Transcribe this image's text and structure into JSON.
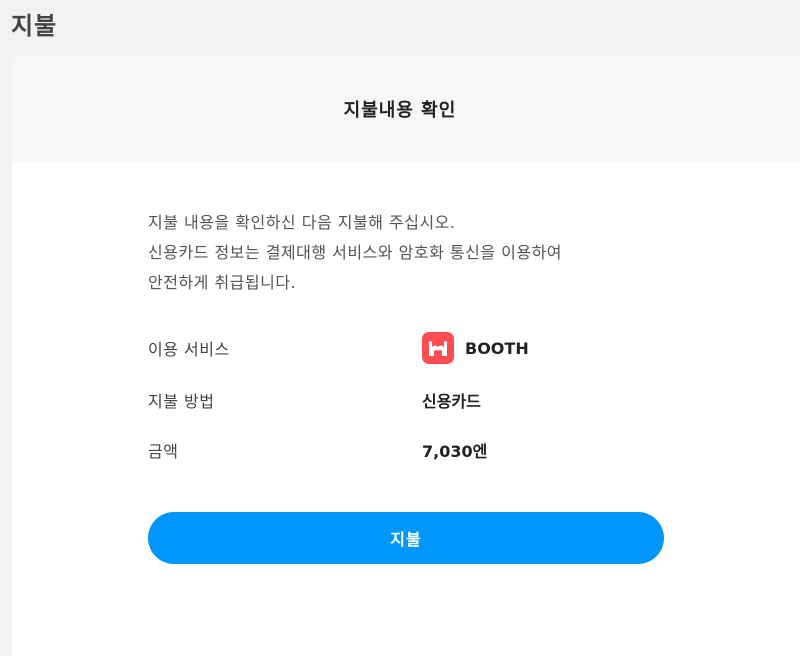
{
  "page": {
    "title": "지불"
  },
  "card": {
    "header_title": "지불내용 확인",
    "notice_lines": [
      "지불 내용을 확인하신 다음 지불해 주십시오.",
      "신용카드 정보는 결제대행 서비스와 암호화 통신을 이용하여",
      "안전하게 취급됩니다."
    ],
    "rows": [
      {
        "label": "이용 서비스",
        "value": "BOOTH",
        "icon": "booth-logo-icon"
      },
      {
        "label": "지불 방법",
        "value": "신용카드"
      },
      {
        "label": "금액",
        "value": "7,030엔"
      }
    ],
    "pay_button_label": "지불"
  },
  "colors": {
    "accent": "#0096fa",
    "booth_brand": "#fc4d50",
    "background": "#f2f2f2"
  }
}
